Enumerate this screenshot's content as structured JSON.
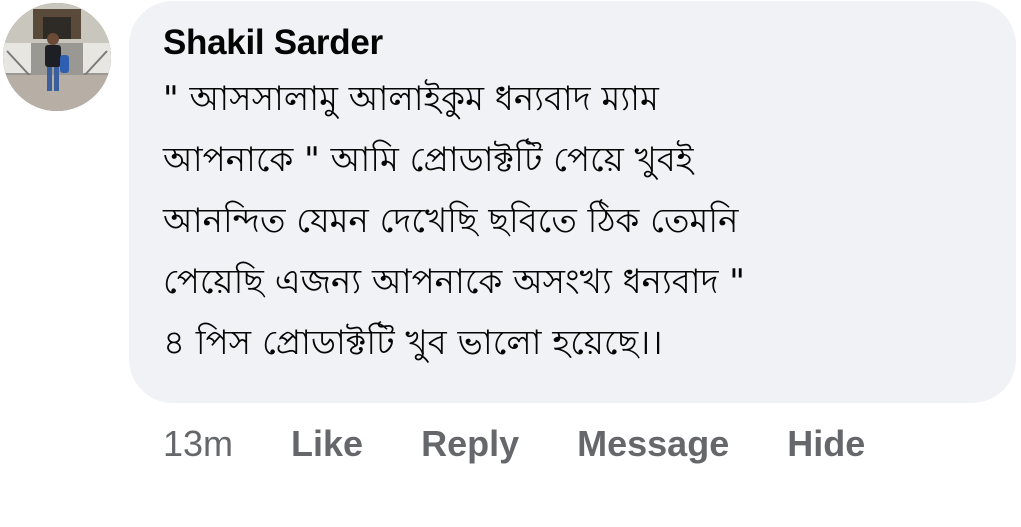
{
  "comment": {
    "author": "Shakil Sarder",
    "lines": [
      "\" আসসালামু আলাইকুম ধন্যবাদ ম্যাম",
      "আপনাকে \" আমি প্রোডাক্টটি পেয়ে খুবই",
      "আনন্দিত যেমন দেখেছি ছবিতে ঠিক তেমনি",
      "পেয়েছি এজন্য আপনাকে অসংখ্য ধন্যবাদ \"",
      "৪ পিস প্রোডাক্টটি খুব ভালো হয়েছে।।"
    ]
  },
  "meta": {
    "timestamp": "13m",
    "like_label": "Like",
    "reply_label": "Reply",
    "message_label": "Message",
    "hide_label": "Hide"
  },
  "colors": {
    "bubble_bg": "#f0f2f5",
    "text": "#050505",
    "secondary_text": "#65676b"
  }
}
